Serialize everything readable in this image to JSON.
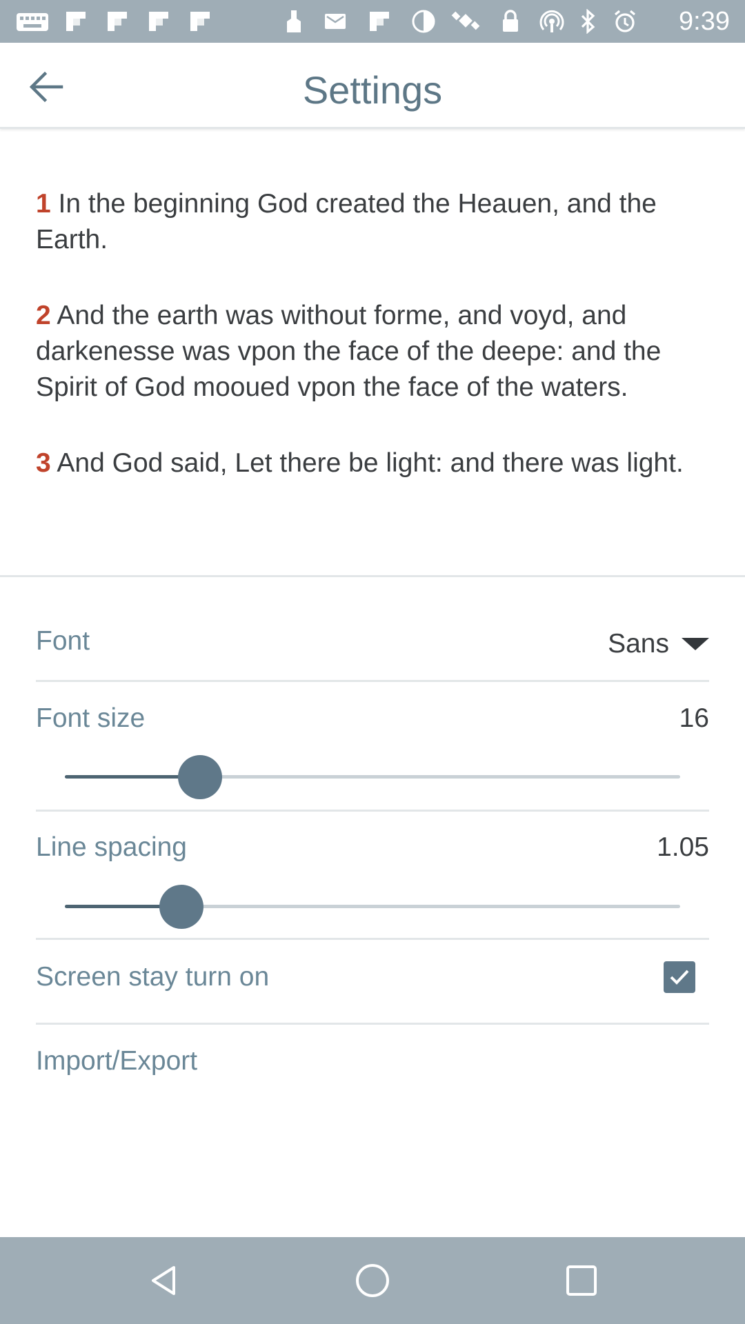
{
  "status_bar": {
    "time": "9:39",
    "icons": [
      "keyboard-icon",
      "flipboard-icon",
      "flipboard-icon",
      "flipboard-icon",
      "flipboard-icon",
      "clean-icon",
      "mail-icon",
      "flipboard-icon",
      "theme-icon",
      "satellite-icon",
      "lock-icon",
      "hotspot-icon",
      "bluetooth-icon",
      "alarm-icon"
    ]
  },
  "appbar": {
    "title": "Settings"
  },
  "preview": {
    "verses": [
      {
        "number": "1",
        "text": " In the beginning God created the Heauen, and the Earth."
      },
      {
        "number": "2",
        "text": " And the earth was without forme, and voyd, and darkenesse was vpon the face of the deepe: and the Spirit of God mooued vpon the face of the waters."
      },
      {
        "number": "3",
        "text": " And God said, Let there be light: and there was light."
      }
    ]
  },
  "settings": {
    "font": {
      "label": "Font",
      "value": "Sans"
    },
    "font_size": {
      "label": "Font size",
      "value": "16",
      "slider_fraction": 0.22
    },
    "line_spacing": {
      "label": "Line spacing",
      "value": "1.05",
      "slider_fraction": 0.19
    },
    "screen_on": {
      "label": "Screen stay turn on",
      "checked": true
    },
    "import_export": {
      "label": "Import/Export"
    }
  },
  "colors": {
    "status_bar": "#9fadb6",
    "accent": "#5f7889",
    "verse_number": "#c0432b",
    "label": "#6a8797"
  }
}
